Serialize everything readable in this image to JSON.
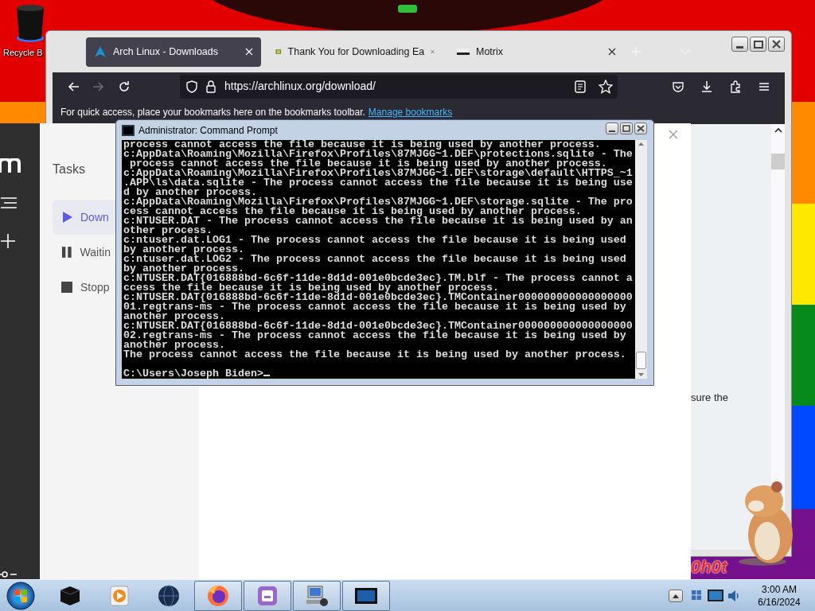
{
  "desktop": {
    "icons": [
      {
        "kind": "bin",
        "label": "Recycle B"
      }
    ],
    "banner_text": "0h0t"
  },
  "browser": {
    "tabs": [
      {
        "kind": "arch",
        "label": "Arch Linux - Downloads",
        "selected": true
      },
      {
        "kind": "download",
        "label": "Thank You for Downloading Ea",
        "selected": false
      },
      {
        "kind": "motrix",
        "label": "Motrix",
        "selected": false
      }
    ],
    "nav_buttons": [
      {
        "kind": "back",
        "disabled": false
      },
      {
        "kind": "forward",
        "disabled": true
      },
      {
        "kind": "reload",
        "disabled": false
      }
    ],
    "url": "https://archlinux.org/download/",
    "bookmarks_hint": "For quick access, place your bookmarks here on the bookmarks toolbar.",
    "bookmarks_link": "Manage bookmarks",
    "page_text": "sure the"
  },
  "motrix": {
    "section_title": "Tasks",
    "items": [
      {
        "kind": "play",
        "label": "Down",
        "selected": true
      },
      {
        "kind": "pause",
        "label": "Waitin",
        "selected": false
      },
      {
        "kind": "stop",
        "label": "Stopp",
        "selected": false
      }
    ]
  },
  "console": {
    "title": "Administrator: Command Prompt",
    "lines": [
      "process cannot access the file because it is being used by another process.",
      "c:AppData\\Roaming\\Mozilla\\Firefox\\Profiles\\87MJGG~1.DEF\\protections.sqlite - The",
      " process cannot access the file because it is being used by another process.",
      "c:AppData\\Roaming\\Mozilla\\Firefox\\Profiles\\87MJGG~1.DEF\\storage\\default\\HTTPS_~1",
      ".APP\\ls\\data.sqlite - The process cannot access the file because it is being use",
      "d by another process.",
      "c:AppData\\Roaming\\Mozilla\\Firefox\\Profiles\\87MJGG~1.DEF\\storage.sqlite - The pro",
      "cess cannot access the file because it is being used by another process.",
      "c:NTUSER.DAT - The process cannot access the file because it is being used by an",
      "other process.",
      "c:ntuser.dat.LOG1 - The process cannot access the file because it is being used",
      "by another process.",
      "c:ntuser.dat.LOG2 - The process cannot access the file because it is being used",
      "by another process.",
      "c:NTUSER.DAT{016888bd-6c6f-11de-8d1d-001e0bcde3ec}.TM.blf - The process cannot a",
      "ccess the file because it is being used by another process.",
      "c:NTUSER.DAT{016888bd-6c6f-11de-8d1d-001e0bcde3ec}.TMContainer000000000000000000",
      "01.regtrans-ms - The process cannot access the file because it is being used by",
      "another process.",
      "c:NTUSER.DAT{016888bd-6c6f-11de-8d1d-001e0bcde3ec}.TMContainer000000000000000000",
      "02.regtrans-ms - The process cannot access the file because it is being used by",
      "another process.",
      "The process cannot access the file because it is being used by another process."
    ],
    "prompt": "C:\\Users\\Joseph Biden>"
  },
  "taskbar": {
    "apps": [
      {
        "kind": "cube",
        "running": false
      },
      {
        "kind": "media",
        "running": false
      },
      {
        "kind": "globe",
        "running": false
      },
      {
        "kind": "firefox",
        "running": true
      },
      {
        "kind": "motrix",
        "running": true
      },
      {
        "kind": "network",
        "running": true
      },
      {
        "kind": "console",
        "running": true
      }
    ],
    "time": "3:00 AM",
    "date": "6/16/2024"
  }
}
